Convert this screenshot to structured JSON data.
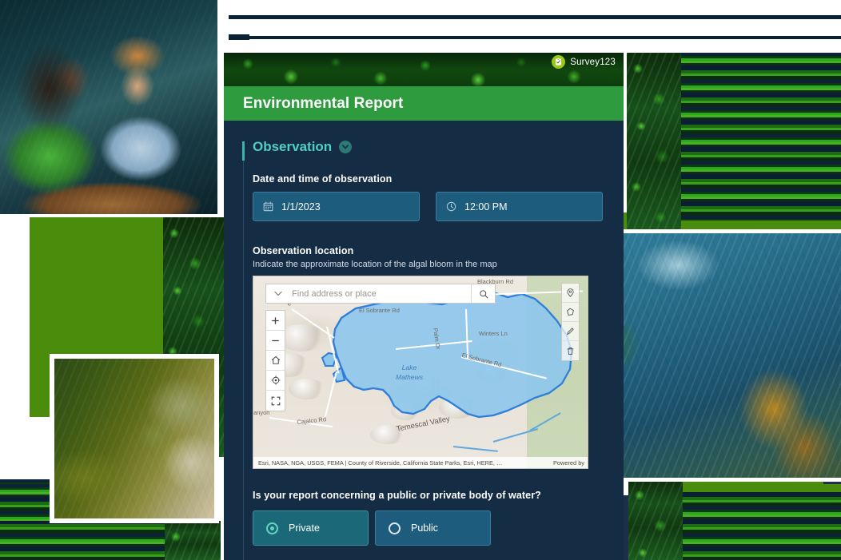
{
  "app": {
    "product_name": "Survey123",
    "product_icon": "survey123-clipboard-icon",
    "form_title": "Environmental Report"
  },
  "group": {
    "title": "Observation",
    "collapse_icon": "chevron-down-icon"
  },
  "fields": {
    "datetime": {
      "label": "Date and time of observation",
      "date": {
        "icon": "calendar-icon",
        "value": "1/1/2023"
      },
      "time": {
        "icon": "clock-icon",
        "value": "12:00 PM"
      }
    },
    "location": {
      "label": "Observation location",
      "hint": "Indicate the approximate location of the algal bloom in the map"
    },
    "water_body": {
      "label": "Is your report concerning a public or private body of water?",
      "options": [
        {
          "label": "Private",
          "selected": true
        },
        {
          "label": "Public",
          "selected": false
        }
      ]
    }
  },
  "map": {
    "search_placeholder": "Find address or place",
    "search_caret_icon": "chevron-down-icon",
    "search_icon": "search-icon",
    "controls": [
      {
        "icon": "plus-icon",
        "name": "zoom-in"
      },
      {
        "icon": "minus-icon",
        "name": "zoom-out"
      },
      {
        "icon": "home-icon",
        "name": "default-extent"
      },
      {
        "icon": "locate-icon",
        "name": "my-location"
      },
      {
        "icon": "fullscreen-icon",
        "name": "expand"
      }
    ],
    "tools": [
      {
        "icon": "point-icon",
        "name": "draw-point"
      },
      {
        "icon": "polygon-icon",
        "name": "draw-polygon"
      },
      {
        "icon": "pencil-icon",
        "name": "edit"
      },
      {
        "icon": "trash-icon",
        "name": "delete"
      }
    ],
    "feature_label": "Lake\nMathews",
    "lake_name_line1": "Lake",
    "lake_name_line2": "Mathews",
    "place_labels": [
      "El Sobrante Rd",
      "Blackburn Rd",
      "Winters Ln",
      "Palm Dr",
      "El Sobrante Rd",
      "Temescal Valley",
      "Cajalco Rd",
      "anyon",
      "e Rd"
    ],
    "attribution": "Esri, NASA, NGA, USGS, FEMA | County of Riverside, California State Parks, Esri, HERE, …",
    "powered_by": "Powered by"
  },
  "colors": {
    "brand_green": "#2e9b3f",
    "panel_navy": "#152c45",
    "accent_teal": "#4fd0c2",
    "input_blue": "#1d5c7c",
    "selected_teal": "#1a6878",
    "lake_blue": "#8ec7ec",
    "lake_outline": "#2f7ed8",
    "stripe_green": "#4a8c0b",
    "rule_navy": "#0b2236"
  },
  "decor": {
    "photos": [
      {
        "name": "photo-people-laptop"
      },
      {
        "name": "photo-algae-bloom"
      },
      {
        "name": "photo-aerial-forest"
      },
      {
        "name": "photo-underwater-kelp"
      }
    ]
  }
}
